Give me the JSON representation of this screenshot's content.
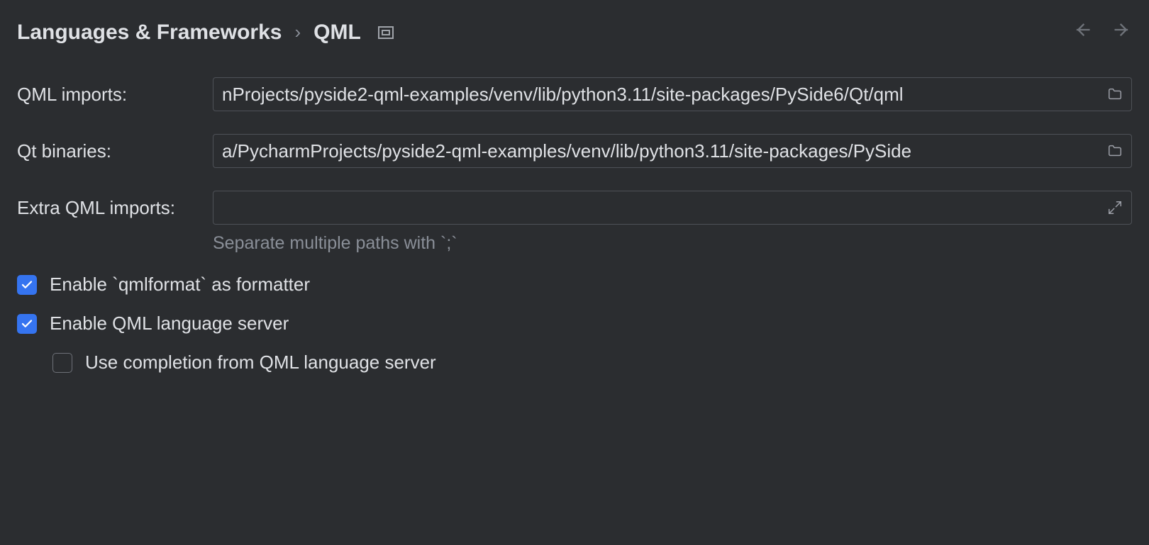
{
  "header": {
    "breadcrumb_root": "Languages & Frameworks",
    "breadcrumb_leaf": "QML"
  },
  "fields": {
    "qml_imports": {
      "label": "QML imports:",
      "value": "nProjects/pyside2-qml-examples/venv/lib/python3.11/site-packages/PySide6/Qt/qml"
    },
    "qt_binaries": {
      "label": "Qt binaries:",
      "value": "a/PycharmProjects/pyside2-qml-examples/venv/lib/python3.11/site-packages/PySide"
    },
    "extra_qml_imports": {
      "label": "Extra QML imports:",
      "value": "",
      "hint": "Separate multiple paths with `;`"
    }
  },
  "checks": {
    "qmlformat": {
      "label": "Enable `qmlformat` as formatter",
      "checked": true
    },
    "lang_server": {
      "label": "Enable QML language server",
      "checked": true
    },
    "completion": {
      "label": "Use completion from QML language server",
      "checked": false
    }
  }
}
